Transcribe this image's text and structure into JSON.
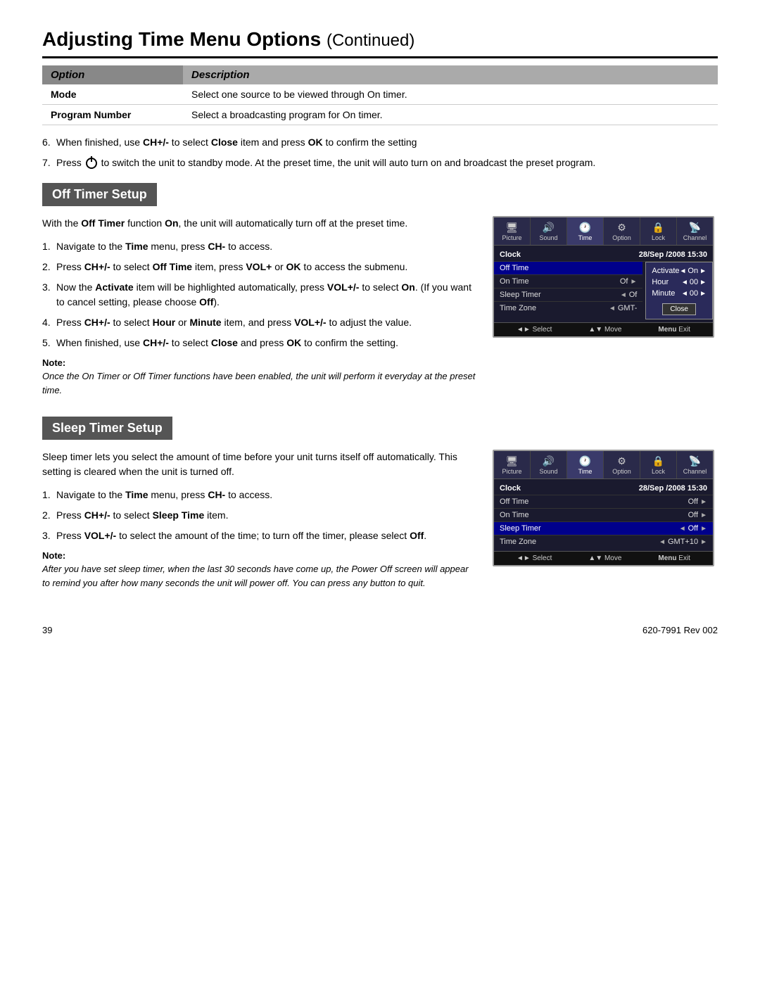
{
  "page": {
    "title": "Adjusting Time Menu Options",
    "title_continued": "Continued",
    "page_number": "39",
    "doc_ref": "620-7991 Rev 002"
  },
  "option_table": {
    "col1_header": "Option",
    "col2_header": "Description",
    "rows": [
      {
        "option": "Mode",
        "description": "Select one source to be viewed through On timer."
      },
      {
        "option": "Program Number",
        "description": "Select a broadcasting program for On timer."
      }
    ]
  },
  "intro_items": [
    {
      "num": "6.",
      "text": "When finished, use CH+/- to select Close item and press OK to confirm the setting"
    },
    {
      "num": "7.",
      "text": "Press  to switch the unit to standby mode. At the preset time, the unit will auto turn on and broadcast the preset program."
    }
  ],
  "off_timer": {
    "header": "Off Timer Setup",
    "intro": "With the Off Timer function On, the unit will automatically turn off at the preset time.",
    "steps": [
      {
        "num": "1.",
        "text": "Navigate to the Time menu, press CH- to access."
      },
      {
        "num": "2.",
        "text": "Press CH+/- to select Off Time item, press VOL+ or OK to access the submenu."
      },
      {
        "num": "3.",
        "text": "Now the Activate item will be highlighted automatically, press VOL+/- to select On. (If you want to cancel setting, please choose Off)."
      },
      {
        "num": "4.",
        "text": "Press CH+/- to select Hour or Minute item, and press VOL+/- to adjust the value."
      },
      {
        "num": "5.",
        "text": "When finished, use CH+/- to select Close and press OK to confirm the setting."
      }
    ],
    "note_label": "Note:",
    "note_text": "Once the On Timer or Off Timer functions have been enabled, the unit will perform it everyday at the preset time.",
    "menu": {
      "icons": [
        {
          "label": "Picture",
          "active": false
        },
        {
          "label": "Sound",
          "active": false
        },
        {
          "label": "Time",
          "active": true
        },
        {
          "label": "Option",
          "active": false
        },
        {
          "label": "Lock",
          "active": false
        },
        {
          "label": "Channel",
          "active": false
        }
      ],
      "header_row": {
        "label": "Clock",
        "value": "28/Sep /2008 15:30"
      },
      "rows": [
        {
          "label": "Off Time",
          "value": "",
          "selected": true
        },
        {
          "label": "On Time",
          "value": "Of",
          "arrow_right": true,
          "has_submenu": true
        },
        {
          "label": "Sleep Timer",
          "value": "Of",
          "arrow_left": true,
          "arrow_right": false
        },
        {
          "label": "Time Zone",
          "value": "GMT-",
          "arrow_left": true
        }
      ],
      "submenu": {
        "rows": [
          {
            "label": "Activate",
            "value": "On",
            "arrow_left": true,
            "arrow_right": true
          },
          {
            "label": "Hour",
            "value": "00",
            "arrow_left": true,
            "arrow_right": true
          },
          {
            "label": "Minute",
            "value": "00",
            "arrow_left": true,
            "arrow_right": true
          }
        ],
        "close_label": "Close"
      },
      "footer": [
        {
          "key": "◄►",
          "label": "Select"
        },
        {
          "key": "▲▼",
          "label": "Move"
        },
        {
          "key": "Menu",
          "label": "Exit"
        }
      ]
    }
  },
  "sleep_timer": {
    "header": "Sleep Timer Setup",
    "intro": "Sleep timer lets you select the amount of time before your unit turns itself off automatically. This setting is cleared when the unit is turned off.",
    "steps": [
      {
        "num": "1.",
        "text": "Navigate to the Time menu, press CH- to access."
      },
      {
        "num": "2.",
        "text": "Press CH+/- to select Sleep Time item."
      },
      {
        "num": "3.",
        "text": "Press VOL+/- to select the amount of the time; to turn off the timer, please select Off."
      }
    ],
    "note_label": "Note:",
    "note_text": "After you have set sleep timer, when the last 30 seconds have come up, the Power Off screen will appear to remind you after how many seconds the unit will power off. You can press any button to quit.",
    "menu": {
      "icons": [
        {
          "label": "Picture",
          "active": false
        },
        {
          "label": "Sound",
          "active": false
        },
        {
          "label": "Time",
          "active": true
        },
        {
          "label": "Option",
          "active": false
        },
        {
          "label": "Lock",
          "active": false
        },
        {
          "label": "Channel",
          "active": false
        }
      ],
      "header_row": {
        "label": "Clock",
        "value": "28/Sep /2008 15:30"
      },
      "rows": [
        {
          "label": "Off Time",
          "value": "Off",
          "arrow_right": true
        },
        {
          "label": "On Time",
          "value": "Off",
          "arrow_right": true
        },
        {
          "label": "Sleep Timer",
          "value": "Off",
          "arrow_left": true,
          "arrow_right": true,
          "selected": true
        },
        {
          "label": "Time Zone",
          "value": "GMT+10",
          "arrow_left": true,
          "arrow_right": true
        }
      ],
      "footer": [
        {
          "key": "◄►",
          "label": "Select"
        },
        {
          "key": "▲▼",
          "label": "Move"
        },
        {
          "key": "Menu",
          "label": "Exit"
        }
      ]
    }
  }
}
